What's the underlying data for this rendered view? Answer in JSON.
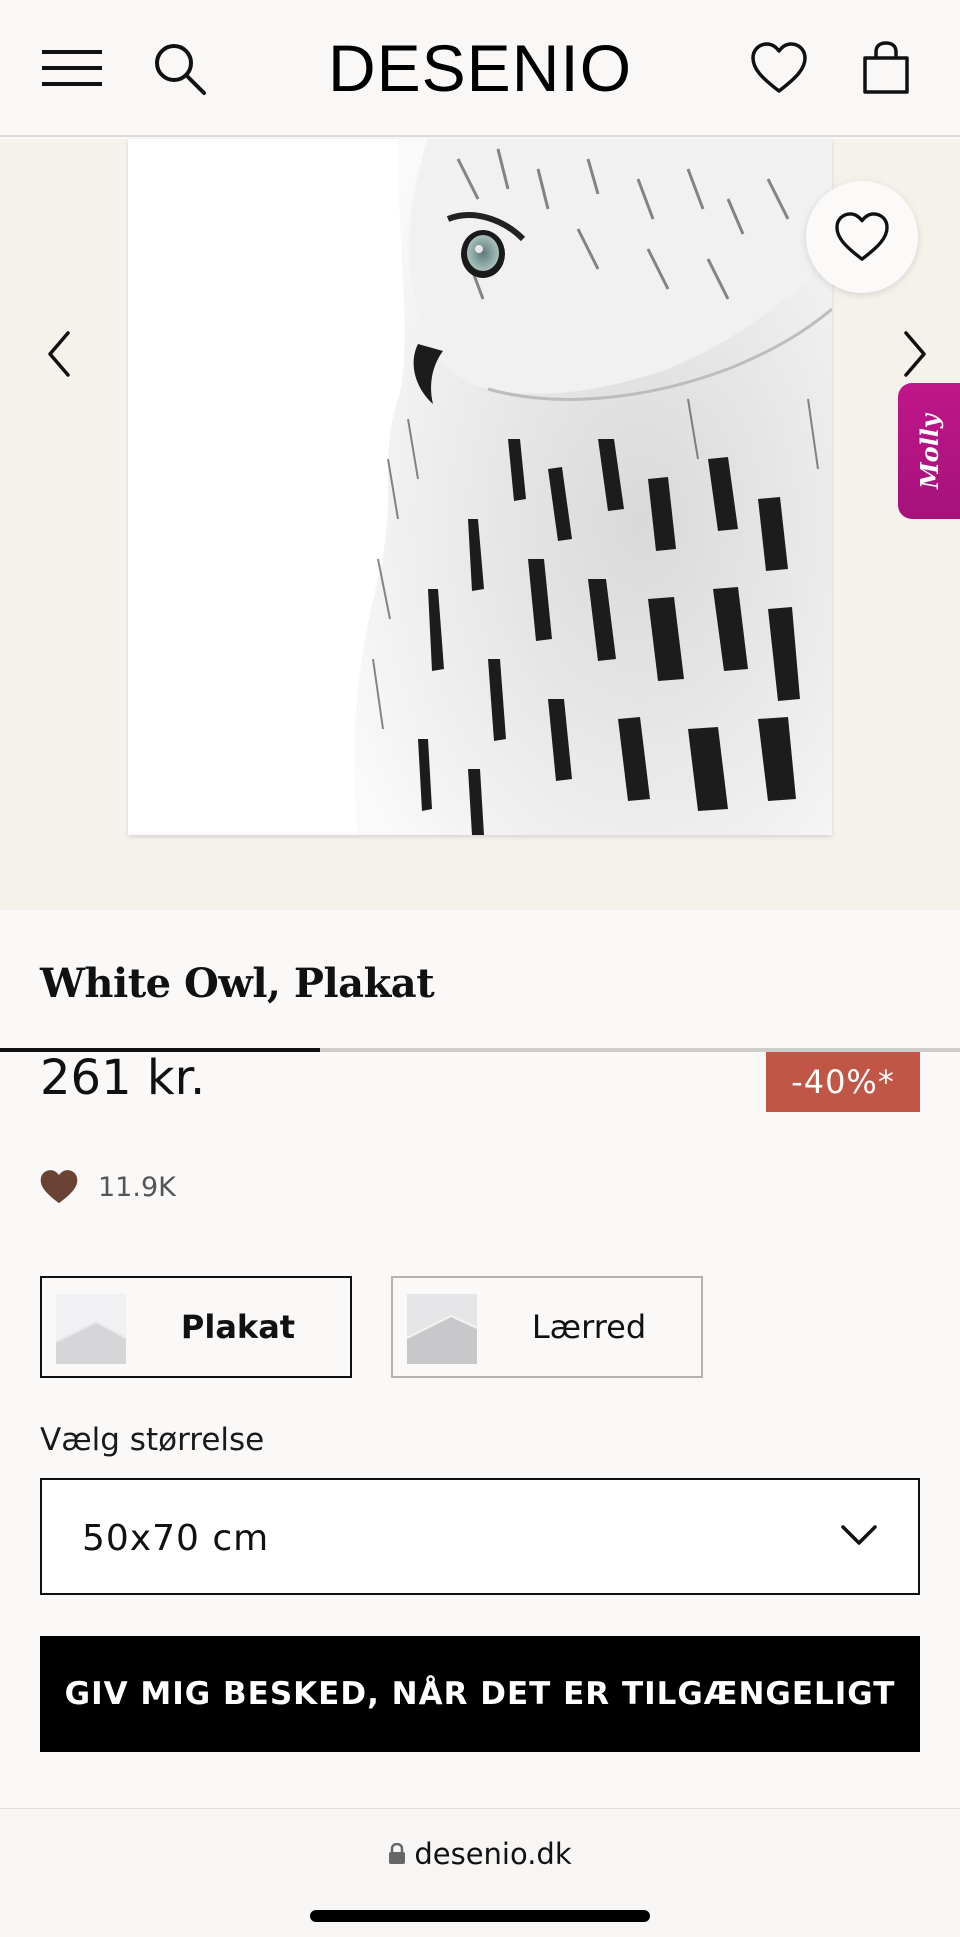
{
  "header": {
    "logo": "DESENIO",
    "icons": {
      "menu": "hamburger-menu-icon",
      "search": "search-icon",
      "wishlist": "heart-outline-icon",
      "cart": "shopping-bag-icon"
    }
  },
  "gallery": {
    "image_alt": "White Owl",
    "molly_label": "Molly",
    "progress_fraction": 0.333,
    "colors": {
      "background": "#f5f1eb",
      "molly_tab": "#b3147f"
    }
  },
  "product": {
    "title": "White Owl, Plakat",
    "price": "261 kr.",
    "discount": "-40%*",
    "likes": "11.9K",
    "options": [
      {
        "label": "Plakat",
        "selected": true
      },
      {
        "label": "Lærred",
        "selected": false
      }
    ],
    "size_label": "Vælg størrelse",
    "size_value": "50x70 cm",
    "notify_button": "GIV MIG BESKED, NÅR DET ER TILGÆNGELIGT",
    "colors": {
      "discount_badge": "#c15546",
      "likes_heart": "#6b4334",
      "cta": "#000000"
    }
  },
  "browser": {
    "url": "desenio.dk"
  }
}
